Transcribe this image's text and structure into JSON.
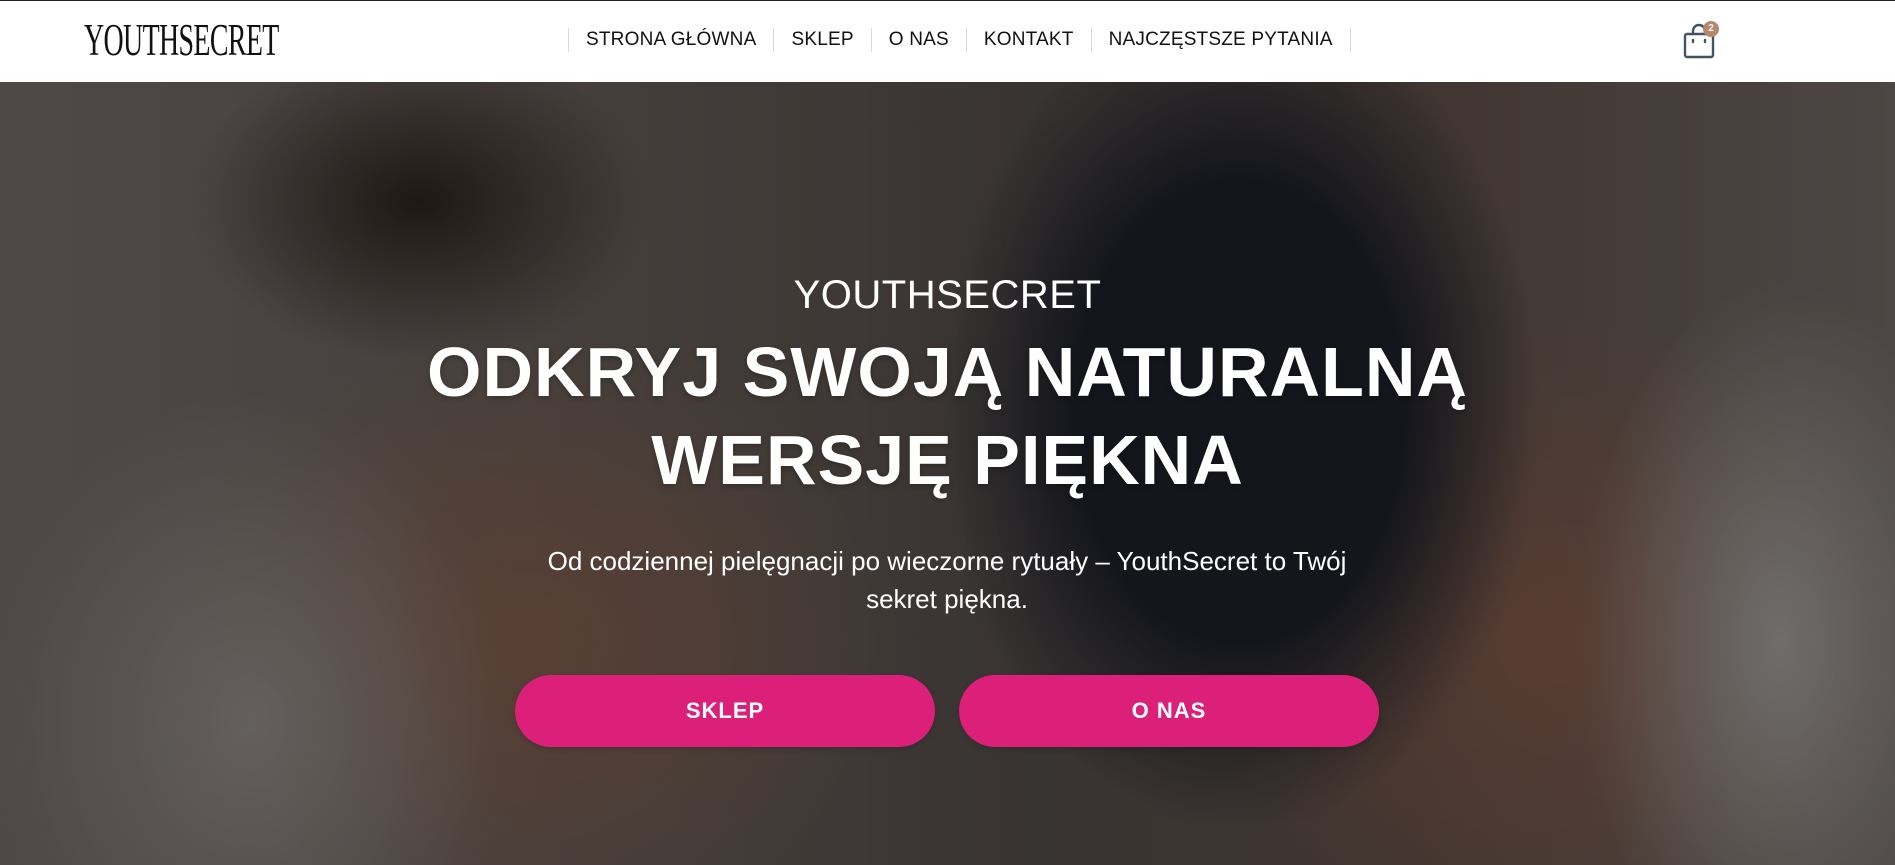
{
  "header": {
    "logo": "YOUTHSECRET",
    "nav": [
      {
        "label": "STRONA GŁÓWNA"
      },
      {
        "label": "SKLEP"
      },
      {
        "label": "O NAS"
      },
      {
        "label": "KONTAKT"
      },
      {
        "label": "NAJCZĘSTSZE PYTANIA"
      }
    ],
    "cart": {
      "icon": "shopping-bag-icon",
      "count": "2",
      "badge_color": "#b7876c"
    }
  },
  "hero": {
    "kicker": "YOUTHSECRET",
    "title_line1": "ODKRYJ SWOJĄ NATURALNĄ",
    "title_line2": "WERSJĘ PIĘKNA",
    "subtitle_line1": "Od codziennej pielęgnacji po wieczorne rytuały – YouthSecret to Twój",
    "subtitle_line2": "sekret piękna.",
    "buttons": {
      "shop": "SKLEP",
      "about": "O NAS"
    },
    "button_color": "#dc2079"
  }
}
